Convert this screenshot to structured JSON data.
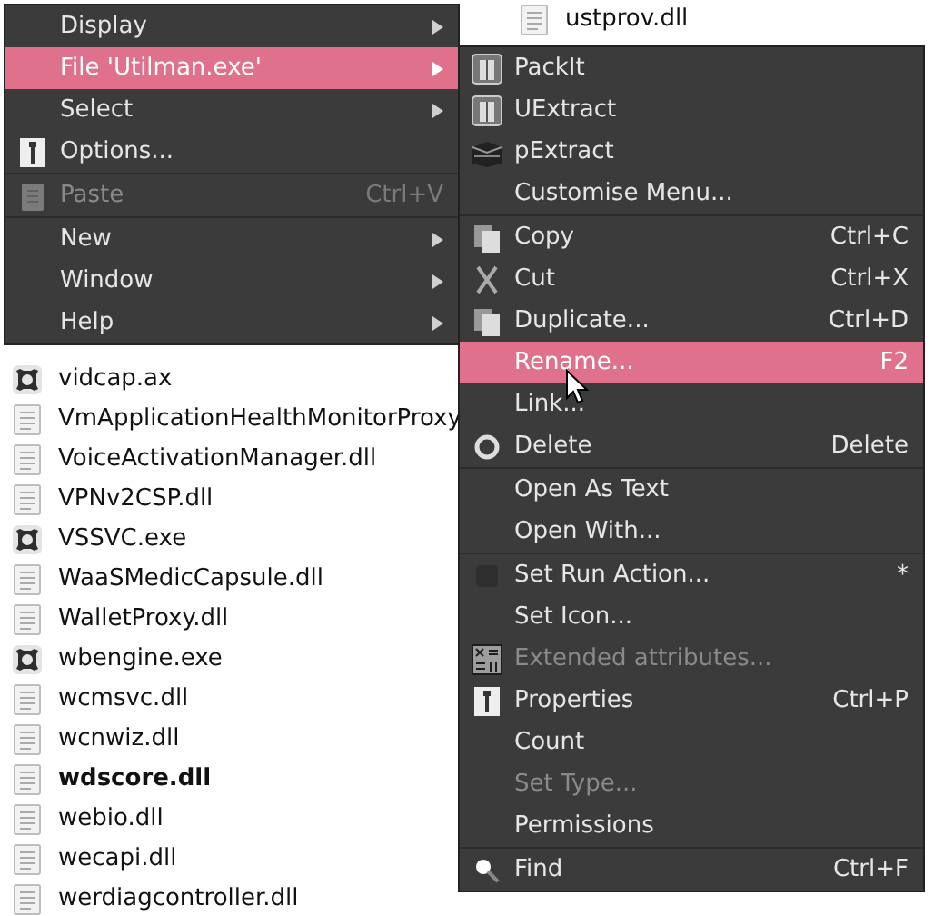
{
  "file_list": {
    "columns": [
      {
        "files": [
          {
            "name": "vidcap.ax",
            "kind": "exe",
            "bold": false
          },
          {
            "name": "VmApplicationHealthMonitorProxy",
            "kind": "dll",
            "bold": false
          },
          {
            "name": "VoiceActivationManager.dll",
            "kind": "dll",
            "bold": false
          },
          {
            "name": "VPNv2CSP.dll",
            "kind": "dll",
            "bold": false
          },
          {
            "name": "VSSVC.exe",
            "kind": "exe",
            "bold": false
          },
          {
            "name": "WaaSMedicCapsule.dll",
            "kind": "dll",
            "bold": false
          },
          {
            "name": "WalletProxy.dll",
            "kind": "dll",
            "bold": false
          },
          {
            "name": "wbengine.exe",
            "kind": "exe",
            "bold": false
          },
          {
            "name": "wcmsvc.dll",
            "kind": "dll",
            "bold": false
          },
          {
            "name": "wcnwiz.dll",
            "kind": "dll",
            "bold": false
          },
          {
            "name": "wdscore.dll",
            "kind": "dll",
            "bold": true
          },
          {
            "name": "webio.dll",
            "kind": "dll",
            "bold": false
          },
          {
            "name": "wecapi.dll",
            "kind": "dll",
            "bold": false
          },
          {
            "name": "werdiagcontroller.dll",
            "kind": "dll",
            "bold": false
          }
        ]
      },
      {
        "files": [
          {
            "name": "ustprov.dll",
            "kind": "dll",
            "bold": false
          }
        ]
      }
    ]
  },
  "context_menu": {
    "items": [
      {
        "kind": "item",
        "label": "Display",
        "submenu": true,
        "disabled": false,
        "selected": false
      },
      {
        "kind": "item",
        "label": "File 'Utilman.exe'",
        "submenu": true,
        "disabled": false,
        "selected": true
      },
      {
        "kind": "item",
        "label": "Select",
        "submenu": true,
        "disabled": false,
        "selected": false
      },
      {
        "kind": "item",
        "label": "Options...",
        "submenu": false,
        "disabled": false,
        "selected": false
      },
      {
        "kind": "separator"
      },
      {
        "kind": "item",
        "label": "Paste",
        "shortcut": "Ctrl+V",
        "submenu": false,
        "disabled": true,
        "selected": false
      },
      {
        "kind": "separator"
      },
      {
        "kind": "item",
        "label": "New",
        "submenu": true,
        "disabled": false,
        "selected": false
      },
      {
        "kind": "item",
        "label": "Window",
        "submenu": true,
        "disabled": false,
        "selected": false
      },
      {
        "kind": "item",
        "label": "Help",
        "submenu": true,
        "disabled": false,
        "selected": false
      }
    ]
  },
  "file_submenu": {
    "items": [
      {
        "kind": "item",
        "label": "PackIt",
        "disabled": false,
        "selected": false
      },
      {
        "kind": "item",
        "label": "UExtract",
        "disabled": false,
        "selected": false
      },
      {
        "kind": "item",
        "label": "pExtract",
        "disabled": false,
        "selected": false
      },
      {
        "kind": "item",
        "label": "Customise Menu...",
        "disabled": false,
        "selected": false
      },
      {
        "kind": "separator"
      },
      {
        "kind": "item",
        "label": "Copy",
        "shortcut": "Ctrl+C",
        "disabled": false,
        "selected": false
      },
      {
        "kind": "item",
        "label": "Cut",
        "shortcut": "Ctrl+X",
        "disabled": false,
        "selected": false
      },
      {
        "kind": "item",
        "label": "Duplicate...",
        "shortcut": "Ctrl+D",
        "disabled": false,
        "selected": false
      },
      {
        "kind": "item",
        "label": "Rename...",
        "shortcut": "F2",
        "disabled": false,
        "selected": true
      },
      {
        "kind": "item",
        "label": "Link...",
        "disabled": false,
        "selected": false
      },
      {
        "kind": "item",
        "label": "Delete",
        "shortcut": "Delete",
        "disabled": false,
        "selected": false
      },
      {
        "kind": "separator"
      },
      {
        "kind": "item",
        "label": "Open As Text",
        "disabled": false,
        "selected": false
      },
      {
        "kind": "item",
        "label": "Open With...",
        "disabled": false,
        "selected": false
      },
      {
        "kind": "separator"
      },
      {
        "kind": "item",
        "label": "Set Run Action...",
        "shortcut": "*",
        "disabled": false,
        "selected": false
      },
      {
        "kind": "item",
        "label": "Set Icon...",
        "disabled": false,
        "selected": false
      },
      {
        "kind": "item",
        "label": "Extended attributes...",
        "disabled": true,
        "selected": false
      },
      {
        "kind": "item",
        "label": "Properties",
        "shortcut": "Ctrl+P",
        "disabled": false,
        "selected": false
      },
      {
        "kind": "item",
        "label": "Count",
        "disabled": false,
        "selected": false
      },
      {
        "kind": "item",
        "label": "Set Type...",
        "disabled": true,
        "selected": false
      },
      {
        "kind": "item",
        "label": "Permissions",
        "disabled": false,
        "selected": false
      },
      {
        "kind": "separator"
      },
      {
        "kind": "item",
        "label": "Find",
        "shortcut": "Ctrl+F",
        "disabled": false,
        "selected": false
      }
    ]
  }
}
